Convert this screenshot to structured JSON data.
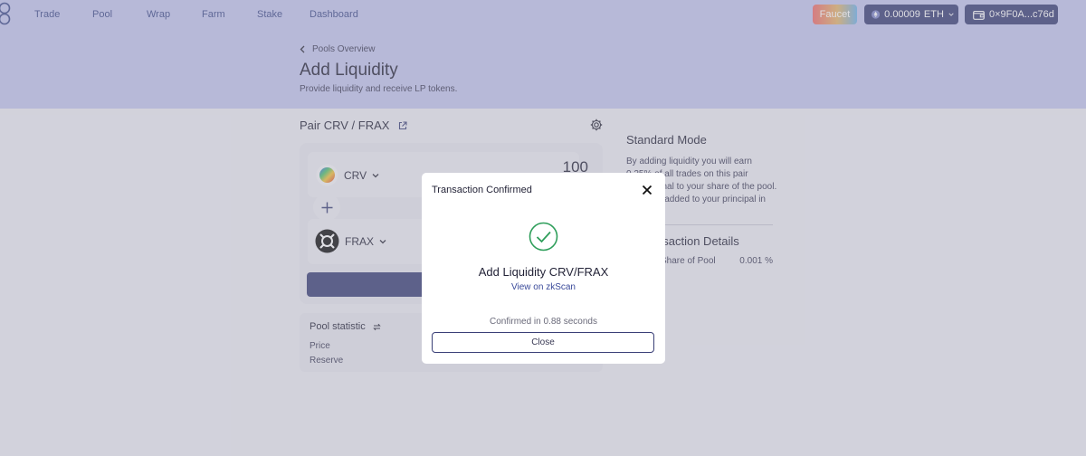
{
  "nav": {
    "items": [
      "Trade",
      "Pool",
      "Wrap",
      "Farm",
      "Stake",
      "Dashboard"
    ],
    "faucet_label": "Faucet",
    "eth_balance": "0.00009",
    "eth_unit": "ETH",
    "wallet_address": "0×9F0A...c76d"
  },
  "header": {
    "back_label": "Pools Overview",
    "title": "Add Liquidity",
    "subtitle": "Provide liquidity and receive LP tokens."
  },
  "pair": {
    "title": "Pair CRV / FRAX",
    "token_a": "CRV",
    "token_b": "FRAX",
    "amount_a": "100"
  },
  "pool_stats": {
    "title": "Pool statistic",
    "price_label": "Price",
    "reserve_label": "Reserve"
  },
  "mode": {
    "title": "Standard Mode",
    "description": "By adding liquidity you will earn 0.25% of all trades on this pair proportional to your share of the pool. Fees are added to your principal in"
  },
  "details": {
    "title": "Transaction Details",
    "share_label": "Share of Pool",
    "share_value": "0.001 %"
  },
  "modal": {
    "title": "Transaction Confirmed",
    "heading": "Add Liquidity CRV/FRAX",
    "link": "View on zkScan",
    "status": "Confirmed in 0.88 seconds",
    "close_label": "Close"
  },
  "colors": {
    "hero_bg": "#c4c6ee",
    "primary": "#3a3f77",
    "success": "#2e9e5a"
  }
}
